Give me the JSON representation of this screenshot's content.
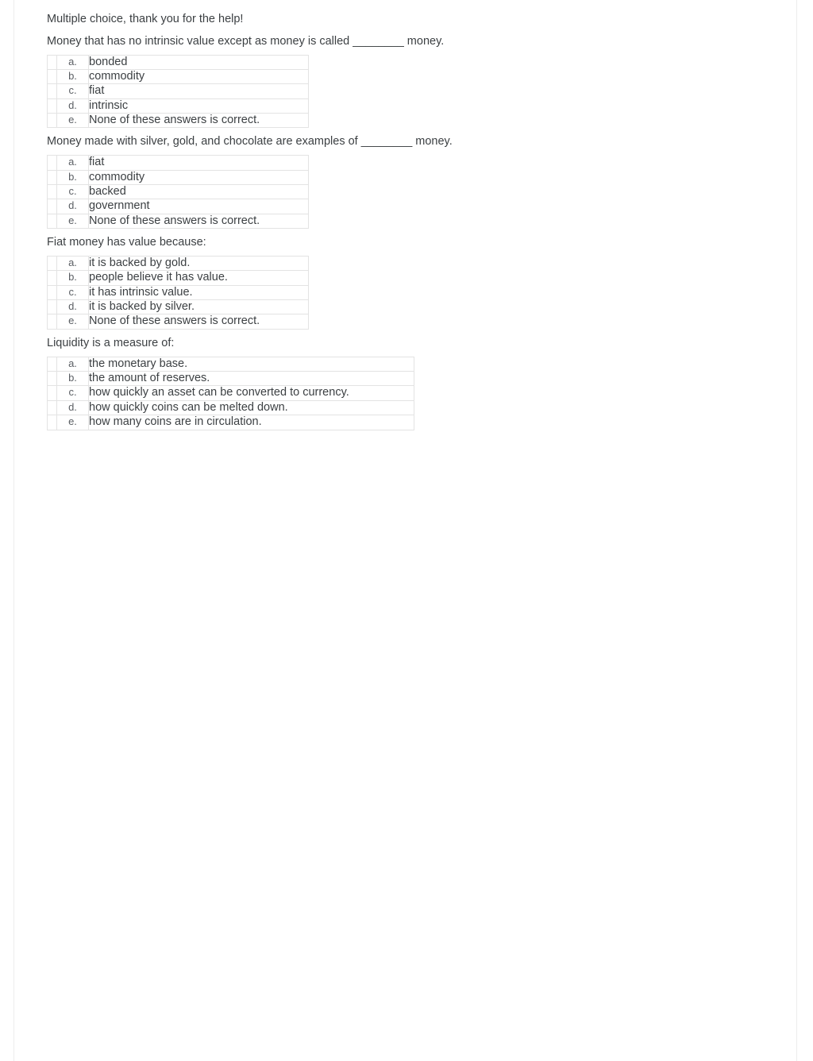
{
  "page": {
    "intro": "Multiple choice, thank you for the help!",
    "text_color": "#3c4043",
    "border_color": "#e3e3e3",
    "background": "#ffffff"
  },
  "questions": [
    {
      "prompt": "Money that has no intrinsic value except as money is called ________ money.",
      "width": "narrow",
      "choices": [
        {
          "letter": "a.",
          "text": "bonded"
        },
        {
          "letter": "b.",
          "text": "commodity"
        },
        {
          "letter": "c.",
          "text": "fiat"
        },
        {
          "letter": "d.",
          "text": "intrinsic"
        },
        {
          "letter": "e.",
          "text": "None of these answers is correct."
        }
      ]
    },
    {
      "prompt": "Money made with silver, gold, and chocolate are examples of ________ money.",
      "width": "narrow",
      "choices": [
        {
          "letter": "a.",
          "text": "fiat"
        },
        {
          "letter": "b.",
          "text": "commodity"
        },
        {
          "letter": "c.",
          "text": "backed"
        },
        {
          "letter": "d.",
          "text": "government"
        },
        {
          "letter": "e.",
          "text": "None of these answers is correct."
        }
      ]
    },
    {
      "prompt": "Fiat money has value because:",
      "width": "narrow",
      "choices": [
        {
          "letter": "a.",
          "text": "it is backed by gold."
        },
        {
          "letter": "b.",
          "text": "people believe it has value."
        },
        {
          "letter": "c.",
          "text": "it has intrinsic value."
        },
        {
          "letter": "d.",
          "text": "it is backed by silver."
        },
        {
          "letter": "e.",
          "text": "None of these answers is correct."
        }
      ]
    },
    {
      "prompt": "Liquidity is a measure of:",
      "width": "wide",
      "choices": [
        {
          "letter": "a.",
          "text": "the monetary base."
        },
        {
          "letter": "b.",
          "text": "the amount of reserves."
        },
        {
          "letter": "c.",
          "text": "how quickly an asset can be converted to currency."
        },
        {
          "letter": "d.",
          "text": "how quickly coins can be melted down."
        },
        {
          "letter": "e.",
          "text": "how many coins are in circulation."
        }
      ]
    }
  ]
}
